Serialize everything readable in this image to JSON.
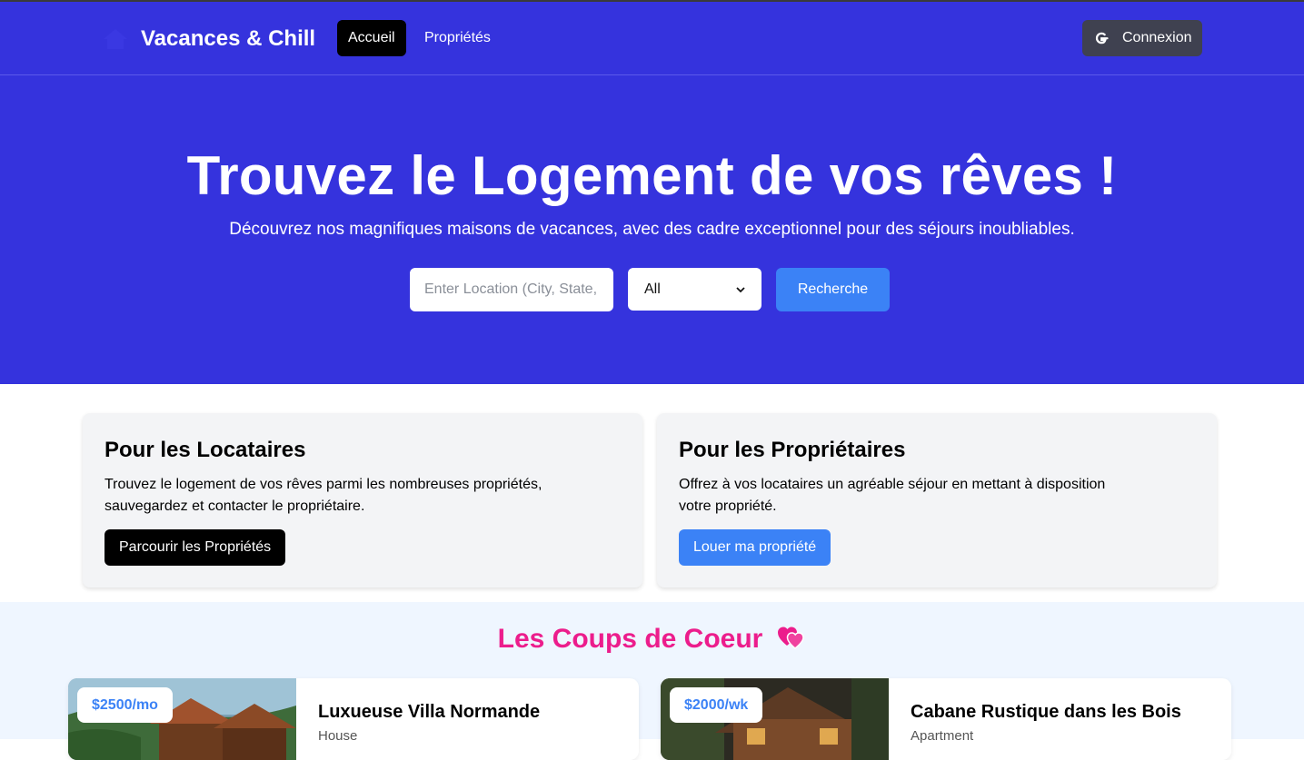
{
  "nav": {
    "brand": "Vacances & Chill",
    "links": [
      {
        "label": "Accueil",
        "active": true
      },
      {
        "label": "Propriétés",
        "active": false
      }
    ],
    "login_label": "Connexion",
    "login_icon": "google-icon"
  },
  "hero": {
    "title": "Trouvez le Logement de vos rêves !",
    "subtitle": "Découvrez nos magnifiques maisons de vacances, avec des cadre exceptionnel pour des séjours inoubliables.",
    "search": {
      "placeholder": "Enter Location (City, State, Zip, etc",
      "value": "",
      "type_selected": "All",
      "button_label": "Recherche"
    }
  },
  "info_cards": [
    {
      "title": "Pour les Locataires",
      "text": "Trouvez le logement de vos rêves parmi les nombreuses propriétés, sauvegardez et contacter le propriétaire.",
      "button_label": "Parcourir les Propriétés",
      "button_color": "#000000"
    },
    {
      "title": "Pour les Propriétaires",
      "text": "Offrez à vos locataires un agréable séjour en mettant à disposition votre propriété.",
      "button_label": "Louer ma propriété",
      "button_color": "#3b82f6"
    }
  ],
  "featured": {
    "title": "Les Coups de Coeur",
    "title_icon": "hearts-icon",
    "properties": [
      {
        "price": "$2500/mo",
        "name": "Luxueuse Villa Normande",
        "type": "House"
      },
      {
        "price": "$2000/wk",
        "name": "Cabane Rustique dans les Bois",
        "type": "Apartment"
      }
    ]
  },
  "colors": {
    "brand_blue": "#3533dd",
    "accent_blue": "#3b82f6",
    "accent_pink": "#ec1d8c"
  }
}
